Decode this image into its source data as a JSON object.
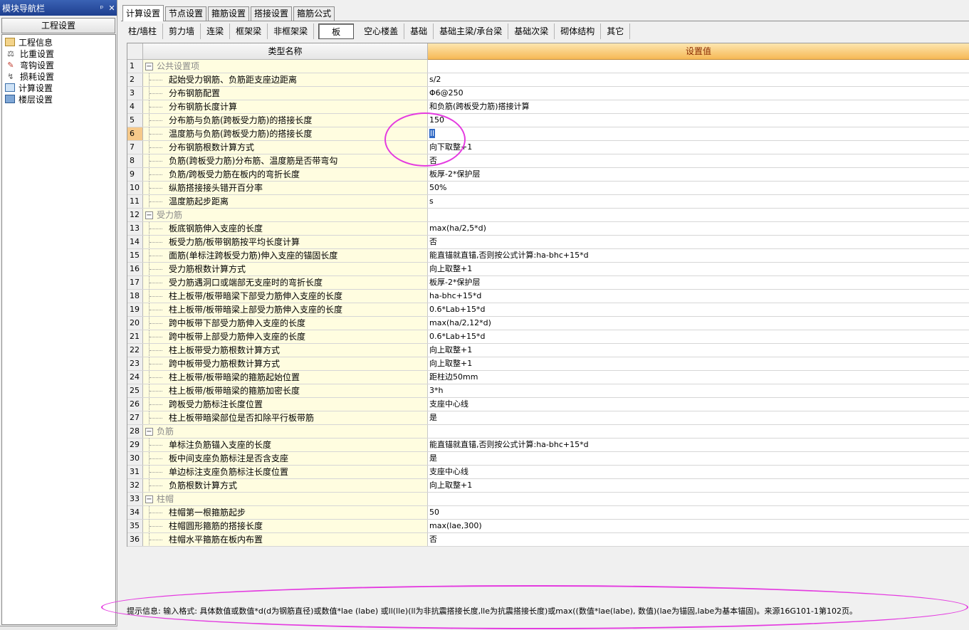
{
  "nav": {
    "title": "模块导航栏",
    "pin_glyph": "ᵖ",
    "close_glyph": "✕",
    "section": "工程设置",
    "items": [
      {
        "label": "工程信息",
        "icon": "project-info-icon"
      },
      {
        "label": "比重设置",
        "icon": "weight-icon"
      },
      {
        "label": "弯钩设置",
        "icon": "hook-icon"
      },
      {
        "label": "损耗设置",
        "icon": "loss-icon"
      },
      {
        "label": "计算设置",
        "icon": "calc-icon"
      },
      {
        "label": "楼层设置",
        "icon": "floor-icon"
      }
    ]
  },
  "tabs": [
    "计算设置",
    "节点设置",
    "箍筋设置",
    "搭接设置",
    "箍筋公式"
  ],
  "active_tab": 0,
  "subtabs": [
    "柱/墙柱",
    "剪力墙",
    "连梁",
    "框架梁",
    "非框架梁",
    "板",
    "空心楼盖",
    "基础",
    "基础主梁/承台梁",
    "基础次梁",
    "砌体结构",
    "其它"
  ],
  "active_subtab": 5,
  "grid": {
    "col_name": "类型名称",
    "col_value": "设置值",
    "selected_row": 6,
    "rows": [
      {
        "n": "1",
        "group": true,
        "name": "公共设置项",
        "value": ""
      },
      {
        "n": "2",
        "name": "起始受力钢筋、负筋距支座边距离",
        "value": "s/2"
      },
      {
        "n": "3",
        "name": "分布钢筋配置",
        "value": "Φ6@250"
      },
      {
        "n": "4",
        "name": "分布钢筋长度计算",
        "value": "和负筋(跨板受力筋)搭接计算"
      },
      {
        "n": "5",
        "name": "分布筋与负筋(跨板受力筋)的搭接长度",
        "value": "150"
      },
      {
        "n": "6",
        "name": "温度筋与负筋(跨板受力筋)的搭接长度",
        "value": "ll",
        "selected": true
      },
      {
        "n": "7",
        "name": "分布钢筋根数计算方式",
        "value": "向下取整+1"
      },
      {
        "n": "8",
        "name": "负筋(跨板受力筋)分布筋、温度筋是否带弯勾",
        "value": "否"
      },
      {
        "n": "9",
        "name": "负筋/跨板受力筋在板内的弯折长度",
        "value": "板厚-2*保护层"
      },
      {
        "n": "10",
        "name": "纵筋搭接接头错开百分率",
        "value": "50%"
      },
      {
        "n": "11",
        "name": "温度筋起步距离",
        "value": "s"
      },
      {
        "n": "12",
        "group": true,
        "name": "受力筋",
        "value": ""
      },
      {
        "n": "13",
        "name": "板底钢筋伸入支座的长度",
        "value": "max(ha/2,5*d)"
      },
      {
        "n": "14",
        "name": "板受力筋/板带钢筋按平均长度计算",
        "value": "否"
      },
      {
        "n": "15",
        "name": "面筋(单标注跨板受力筋)伸入支座的锚固长度",
        "value": "能直锚就直锚,否则按公式计算:ha-bhc+15*d"
      },
      {
        "n": "16",
        "name": "受力筋根数计算方式",
        "value": "向上取整+1"
      },
      {
        "n": "17",
        "name": "受力筋遇洞口或端部无支座时的弯折长度",
        "value": "板厚-2*保护层"
      },
      {
        "n": "18",
        "name": "柱上板带/板带暗梁下部受力筋伸入支座的长度",
        "value": "ha-bhc+15*d"
      },
      {
        "n": "19",
        "name": "柱上板带/板带暗梁上部受力筋伸入支座的长度",
        "value": "0.6*Lab+15*d"
      },
      {
        "n": "20",
        "name": "跨中板带下部受力筋伸入支座的长度",
        "value": "max(ha/2,12*d)"
      },
      {
        "n": "21",
        "name": "跨中板带上部受力筋伸入支座的长度",
        "value": "0.6*Lab+15*d"
      },
      {
        "n": "22",
        "name": "柱上板带受力筋根数计算方式",
        "value": "向上取整+1"
      },
      {
        "n": "23",
        "name": "跨中板带受力筋根数计算方式",
        "value": "向上取整+1"
      },
      {
        "n": "24",
        "name": "柱上板带/板带暗梁的箍筋起始位置",
        "value": "距柱边50mm"
      },
      {
        "n": "25",
        "name": "柱上板带/板带暗梁的箍筋加密长度",
        "value": "3*h"
      },
      {
        "n": "26",
        "name": "跨板受力筋标注长度位置",
        "value": "支座中心线"
      },
      {
        "n": "27",
        "name": "柱上板带暗梁部位是否扣除平行板带筋",
        "value": "是"
      },
      {
        "n": "28",
        "group": true,
        "name": "负筋",
        "value": ""
      },
      {
        "n": "29",
        "name": "单标注负筋锚入支座的长度",
        "value": "能直锚就直锚,否则按公式计算:ha-bhc+15*d"
      },
      {
        "n": "30",
        "name": "板中间支座负筋标注是否含支座",
        "value": "是"
      },
      {
        "n": "31",
        "name": "单边标注支座负筋标注长度位置",
        "value": "支座中心线"
      },
      {
        "n": "32",
        "name": "负筋根数计算方式",
        "value": "向上取整+1"
      },
      {
        "n": "33",
        "group": true,
        "name": "柱帽",
        "value": ""
      },
      {
        "n": "34",
        "name": "柱帽第一根箍筋起步",
        "value": "50"
      },
      {
        "n": "35",
        "name": "柱帽圆形箍筋的搭接长度",
        "value": "max(lae,300)"
      },
      {
        "n": "36",
        "name": "柱帽水平箍筋在板内布置",
        "value": "否"
      }
    ]
  },
  "hint": "提示信息: 输入格式: 具体数值或数值*d(d为钢筋直径)或数值*lae (labe) 或ll(lle)(ll为非抗震搭接长度,lle为抗震搭接长度)或max((数值*lae(labe), 数值)(lae为锚固,labe为基本锚固)。来源16G101-1第102页。",
  "annotation_color": "#e43be0"
}
